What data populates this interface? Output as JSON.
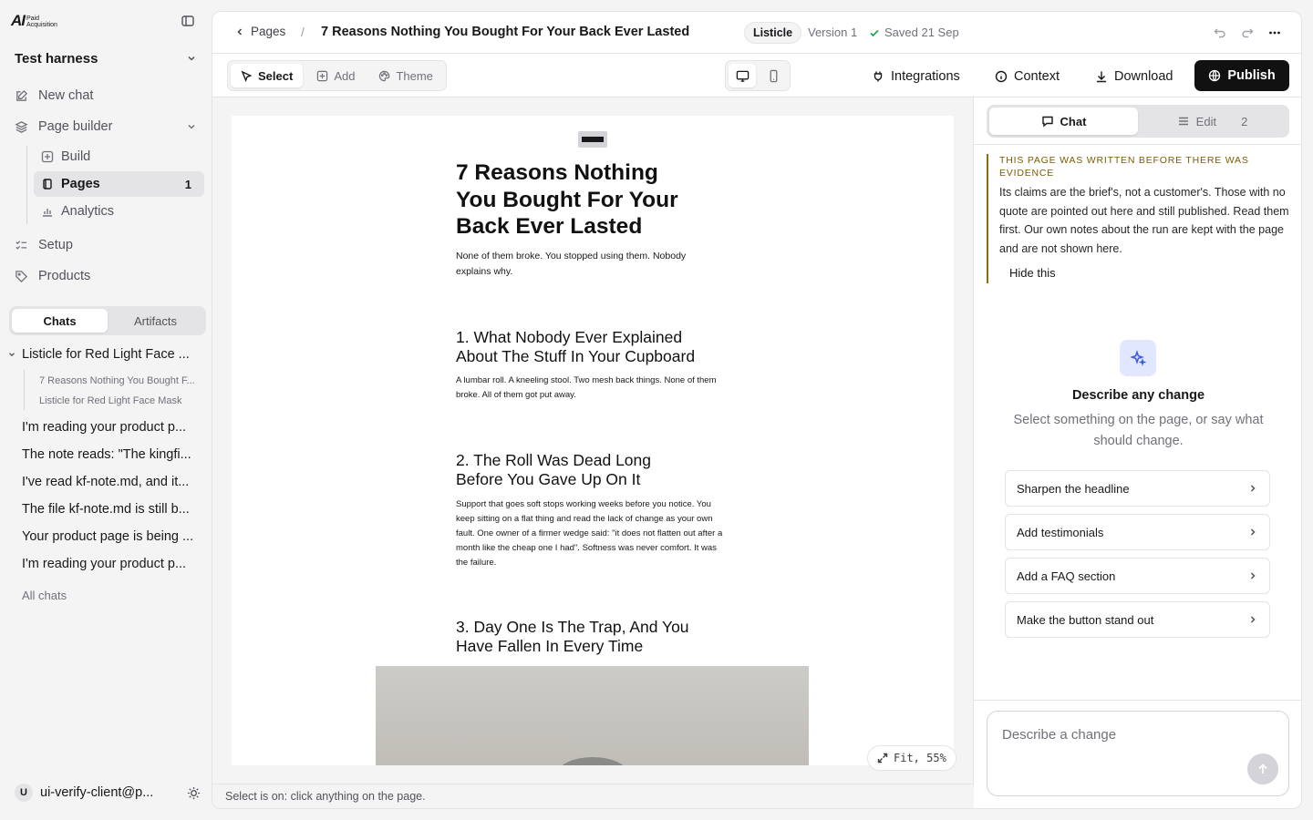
{
  "brand": {
    "logo_main": "AI",
    "logo_sub": "Paid Acquisition"
  },
  "sidebar": {
    "workspace": "Test harness",
    "new_chat": "New chat",
    "page_builder": "Page builder",
    "sub_items": [
      {
        "label": "Build"
      },
      {
        "label": "Pages",
        "count": "1"
      },
      {
        "label": "Analytics"
      }
    ],
    "setup": "Setup",
    "products": "Products",
    "tabs": [
      "Chats",
      "Artifacts"
    ],
    "chat_group": {
      "title": "Listicle for Red Light Face ...",
      "children": [
        "7 Reasons Nothing You Bought F...",
        "Listicle for Red Light Face Mask"
      ]
    },
    "chats": [
      "I'm reading your product p...",
      "The note reads: \"The kingfi...",
      "I've read kf-note.md, and it...",
      "The file kf-note.md is still b...",
      "Your product page is being ...",
      "I'm reading your product p..."
    ],
    "all_chats": "All chats",
    "user": {
      "initial": "U",
      "email": "ui-verify-client@p..."
    }
  },
  "topbar": {
    "back_label": "Pages",
    "separator": "/",
    "title": "7 Reasons Nothing You Bought For Your Back Ever Lasted",
    "badge": "Listicle",
    "version": "Version 1",
    "saved": "Saved 21 Sep"
  },
  "toolbar": {
    "modes": [
      "Select",
      "Add",
      "Theme"
    ],
    "integrations": "Integrations",
    "context": "Context",
    "download": "Download",
    "publish": "Publish"
  },
  "preview": {
    "h1": "7 Reasons Nothing You Bought For Your Back Ever Lasted",
    "intro": "None of them broke. You stopped using them. Nobody explains why.",
    "sections": [
      {
        "heading": "1. What Nobody Ever Explained About The Stuff In Your Cupboard",
        "body": "A lumbar roll. A kneeling stool. Two mesh back things. None of them broke. All of them got put away."
      },
      {
        "heading": "2. The Roll Was Dead Long Before You Gave Up On It",
        "body": "Support that goes soft stops working weeks before you notice. You keep sitting on a flat thing and read the lack of change as your own fault. One owner of a firmer wedge said: \"it does not flatten out after a month like the cheap one I had\". Softness was never comfort. It was the failure."
      },
      {
        "heading": "3. Day One Is The Trap, And You Have Fallen In Every Time",
        "body": ""
      }
    ],
    "zoom_label": "Fit, 55%"
  },
  "status": "Select is on: click anything on the page.",
  "panel": {
    "tabs": [
      {
        "label": "Chat"
      },
      {
        "label": "Edit",
        "count": "2"
      }
    ],
    "notice": {
      "title": "THIS PAGE WAS WRITTEN BEFORE THERE WAS EVIDENCE",
      "body": "Its claims are the brief's, not a customer's. Those with no quote are pointed out here and still published. Read them first. Our own notes about the run are kept with the page and are not shown here.",
      "hide": "Hide this"
    },
    "empty_title": "Describe any change",
    "empty_sub": "Select something on the page, or say what should change.",
    "suggestions": [
      "Sharpen the headline",
      "Add testimonials",
      "Add a FAQ section",
      "Make the button stand out"
    ],
    "composer_placeholder": "Describe a change"
  },
  "colors": {
    "accent": "#111111",
    "notice": "#8a6d10",
    "active_bg": "#e4e4e7"
  }
}
